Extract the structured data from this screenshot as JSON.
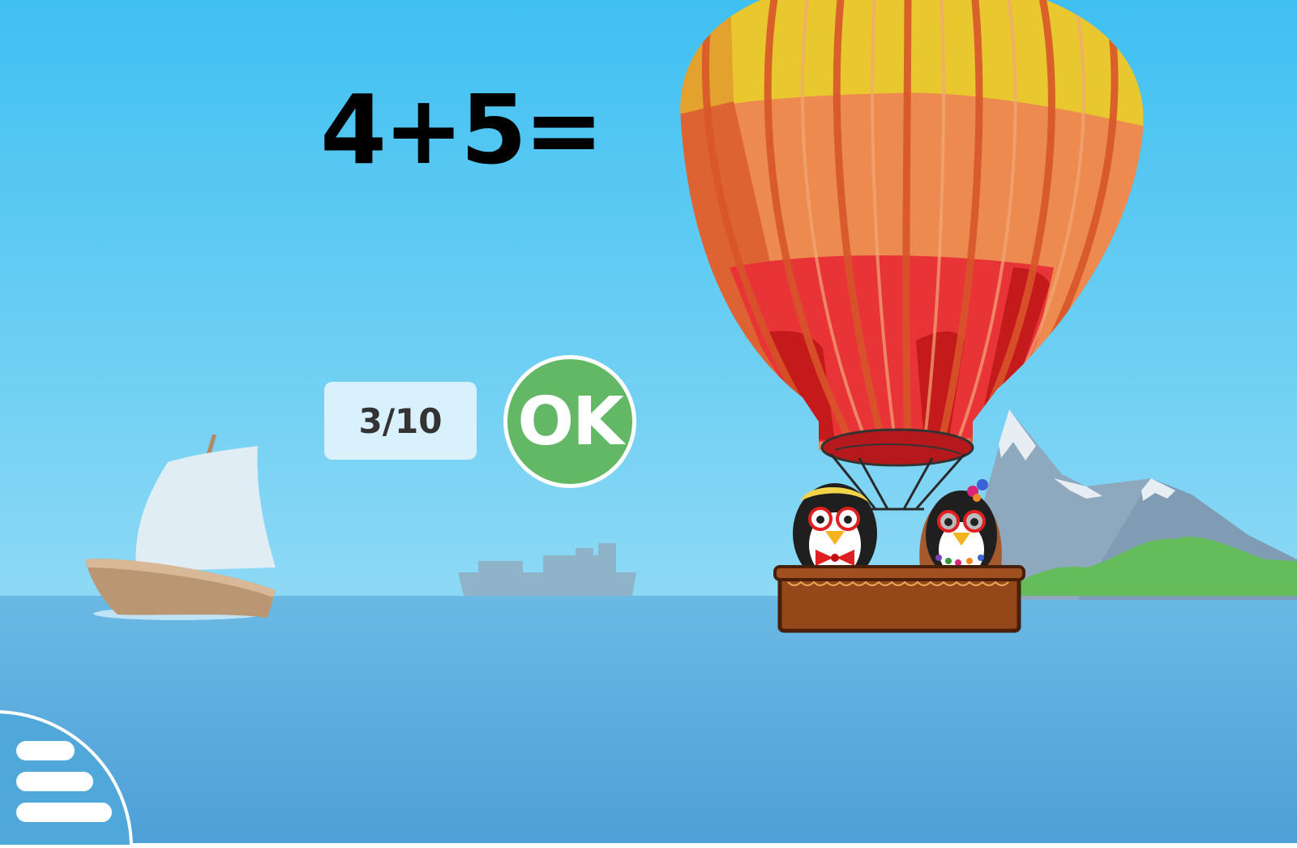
{
  "game": {
    "question": {
      "operand_a": "4",
      "operator": "+",
      "operand_b": "5",
      "equals": "="
    },
    "answer_value": "",
    "progress": {
      "label": "3/10",
      "current": 3,
      "total": 10
    },
    "ok_button": {
      "label": "OK"
    },
    "menu_button": {
      "icon": "hamburger-menu-icon"
    }
  },
  "colors": {
    "sky_top": "#3fc0f1",
    "sky_bottom": "#8dd9f5",
    "sea_top": "#6ab9e4",
    "sea_bottom": "#4f9fd8",
    "ok_green": "#62b864",
    "progress_bg": "#d9f1fc",
    "balloon_yellow": "#e8c72f",
    "balloon_orange": "#ec8a4f",
    "balloon_red": "#e83337",
    "basket_brown": "#94481a"
  }
}
